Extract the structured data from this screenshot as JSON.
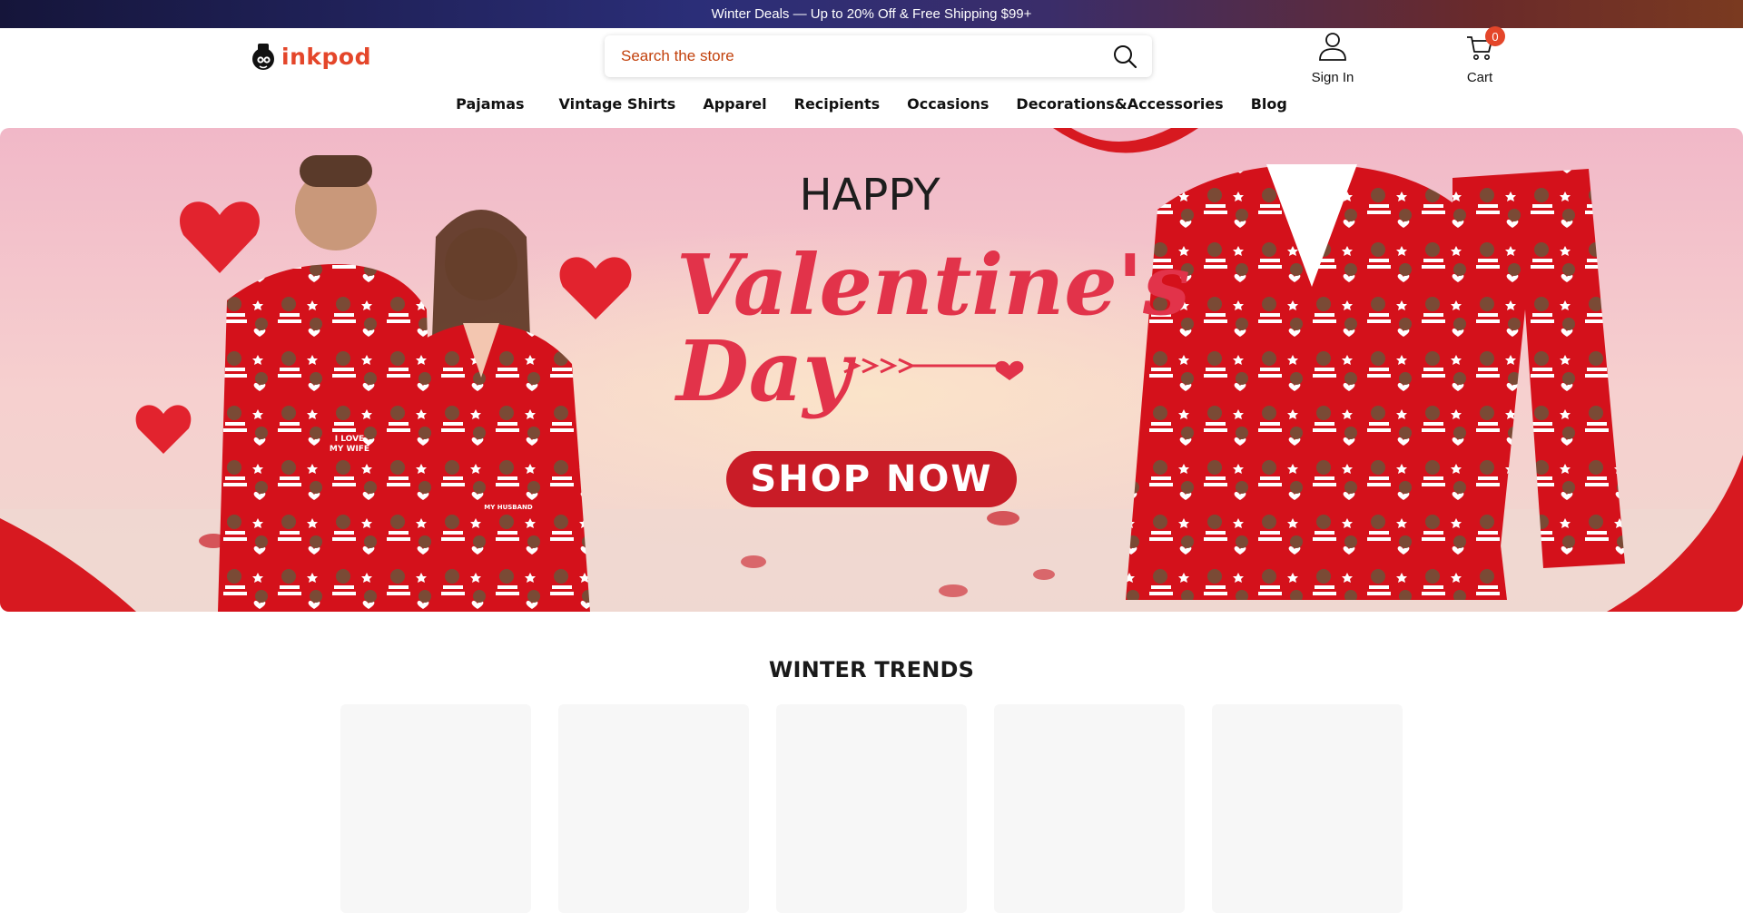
{
  "announcement": {
    "text": "Winter Deals — Up to 20% Off & Free Shipping $99+"
  },
  "header": {
    "logo_text": "inkpod",
    "search": {
      "placeholder": "Search the store",
      "icon": "search-icon"
    },
    "account": {
      "label": "Sign In",
      "icon": "user-icon"
    },
    "cart": {
      "label": "Cart",
      "count": "0",
      "icon": "cart-icon"
    }
  },
  "nav": {
    "items": [
      {
        "label": "Pajamas"
      },
      {
        "label": "Vintage Shirts"
      },
      {
        "label": "Apparel"
      },
      {
        "label": "Recipients"
      },
      {
        "label": "Occasions"
      },
      {
        "label": "Decorations&Accessories"
      },
      {
        "label": "Blog"
      }
    ]
  },
  "hero": {
    "line1": "HAPPY",
    "line2": "Valentine's",
    "line3": "Day",
    "cta": "SHOP NOW",
    "print_text_1": "I LOVE",
    "print_text_2": "MY WIFE",
    "print_text_3": "MY HUSBAND",
    "colors": {
      "background": "#f2c6cf",
      "pajama": "#d4111b",
      "accent": "#e2334a",
      "button": "#c91c27"
    }
  },
  "section": {
    "title": "WINTER TRENDS",
    "card_count": 5
  }
}
